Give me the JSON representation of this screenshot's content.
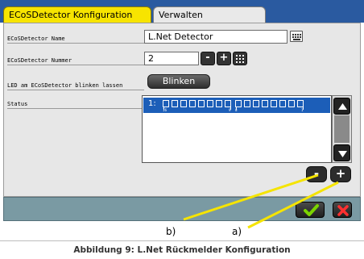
{
  "tabs": [
    {
      "label": "ECoSDetector Konfiguration",
      "active": true
    },
    {
      "label": "Verwalten",
      "active": false
    }
  ],
  "form": {
    "name_label": "ECoSDetector Name",
    "name_value": "L.Net Detector",
    "number_label": "ECoSDetector Nummer",
    "number_value": "2",
    "blink_label": "LED am ECoSDetector blinken lassen",
    "blink_button": "Blinken",
    "status_label": "Status"
  },
  "status_list": {
    "rows": [
      {
        "index": "1:",
        "groups": [
          [
            "16",
            "9"
          ],
          [
            "8",
            "1"
          ]
        ]
      }
    ]
  },
  "buttons": {
    "minus": "-",
    "plus": "+",
    "list_remove": "-",
    "list_add": "+"
  },
  "annotations": {
    "b": "b)",
    "a": "a)"
  },
  "caption": "Abbildung 9: L.Net Rückmelder Konfiguration",
  "colors": {
    "tab_active": "#f7e400",
    "tab_bar": "#2a5aa0",
    "selection": "#1c5eb8",
    "highlight": "#f5e400",
    "ok_check": "#7bd400",
    "cancel_x": "#ff3030"
  },
  "icons": {
    "keyboard": "keyboard-icon",
    "check": "check-icon",
    "close": "close-icon"
  }
}
